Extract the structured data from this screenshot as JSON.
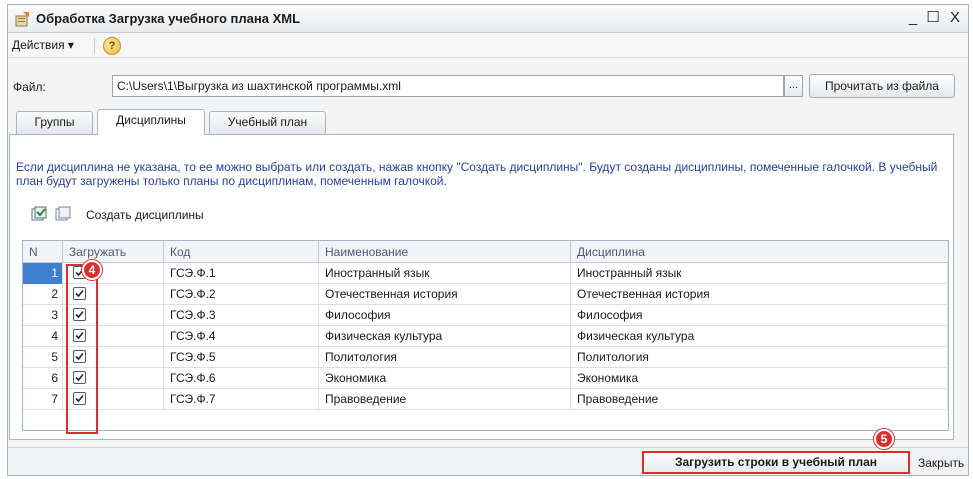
{
  "window": {
    "title": "Обработка  Загрузка учебного плана XML",
    "minimize": "_",
    "maximize": "☐",
    "close": "X"
  },
  "menu": {
    "actions": "Действия ▾",
    "help": "?"
  },
  "file": {
    "label": "Файл:",
    "value": "C:\\Users\\1\\Выгрузка из шахтинской программы.xml",
    "browse": "...",
    "read_button": "Прочитать из файла"
  },
  "tabs": [
    {
      "label": "Группы"
    },
    {
      "label": "Дисциплины"
    },
    {
      "label": "Учебный план"
    }
  ],
  "info_text": "Если дисциплина не указана, то ее можно выбрать или создать, нажав кнопку \"Создать дисциплины\". Будут созданы дисциплины, помеченные галочкой. В учебный план будут загружены только планы по дисциплинам, помеченным галочкой.",
  "toolbar": {
    "create_label": "Создать дисциплины"
  },
  "table": {
    "columns": [
      "N",
      "Загружать",
      "Код",
      "Наименование",
      "Дисциплина"
    ],
    "rows": [
      {
        "n": "1",
        "load": true,
        "code": "ГСЭ.Ф.1",
        "name": "Иностранный язык",
        "discipline": "Иностранный язык"
      },
      {
        "n": "2",
        "load": true,
        "code": "ГСЭ.Ф.2",
        "name": "Отечественная история",
        "discipline": "Отечественная история"
      },
      {
        "n": "3",
        "load": true,
        "code": "ГСЭ.Ф.3",
        "name": "Философия",
        "discipline": "Философия"
      },
      {
        "n": "4",
        "load": true,
        "code": "ГСЭ.Ф.4",
        "name": "Физическая культура",
        "discipline": "Физическая культура"
      },
      {
        "n": "5",
        "load": true,
        "code": "ГСЭ.Ф.5",
        "name": "Политология",
        "discipline": "Политология"
      },
      {
        "n": "6",
        "load": true,
        "code": "ГСЭ.Ф.6",
        "name": "Экономика",
        "discipline": "Экономика"
      },
      {
        "n": "7",
        "load": true,
        "code": "ГСЭ.Ф.7",
        "name": "Правоведение",
        "discipline": "Правоведение"
      }
    ]
  },
  "annotations": {
    "badge_load_column": "4",
    "badge_load_button": "5"
  },
  "buttons": {
    "load_rows": "Загрузить строки в учебный план",
    "close": "Закрыть"
  },
  "colors": {
    "accent_red": "#d8302e",
    "info_text": "#2a3f9a",
    "selection": "#3c7fcf"
  }
}
